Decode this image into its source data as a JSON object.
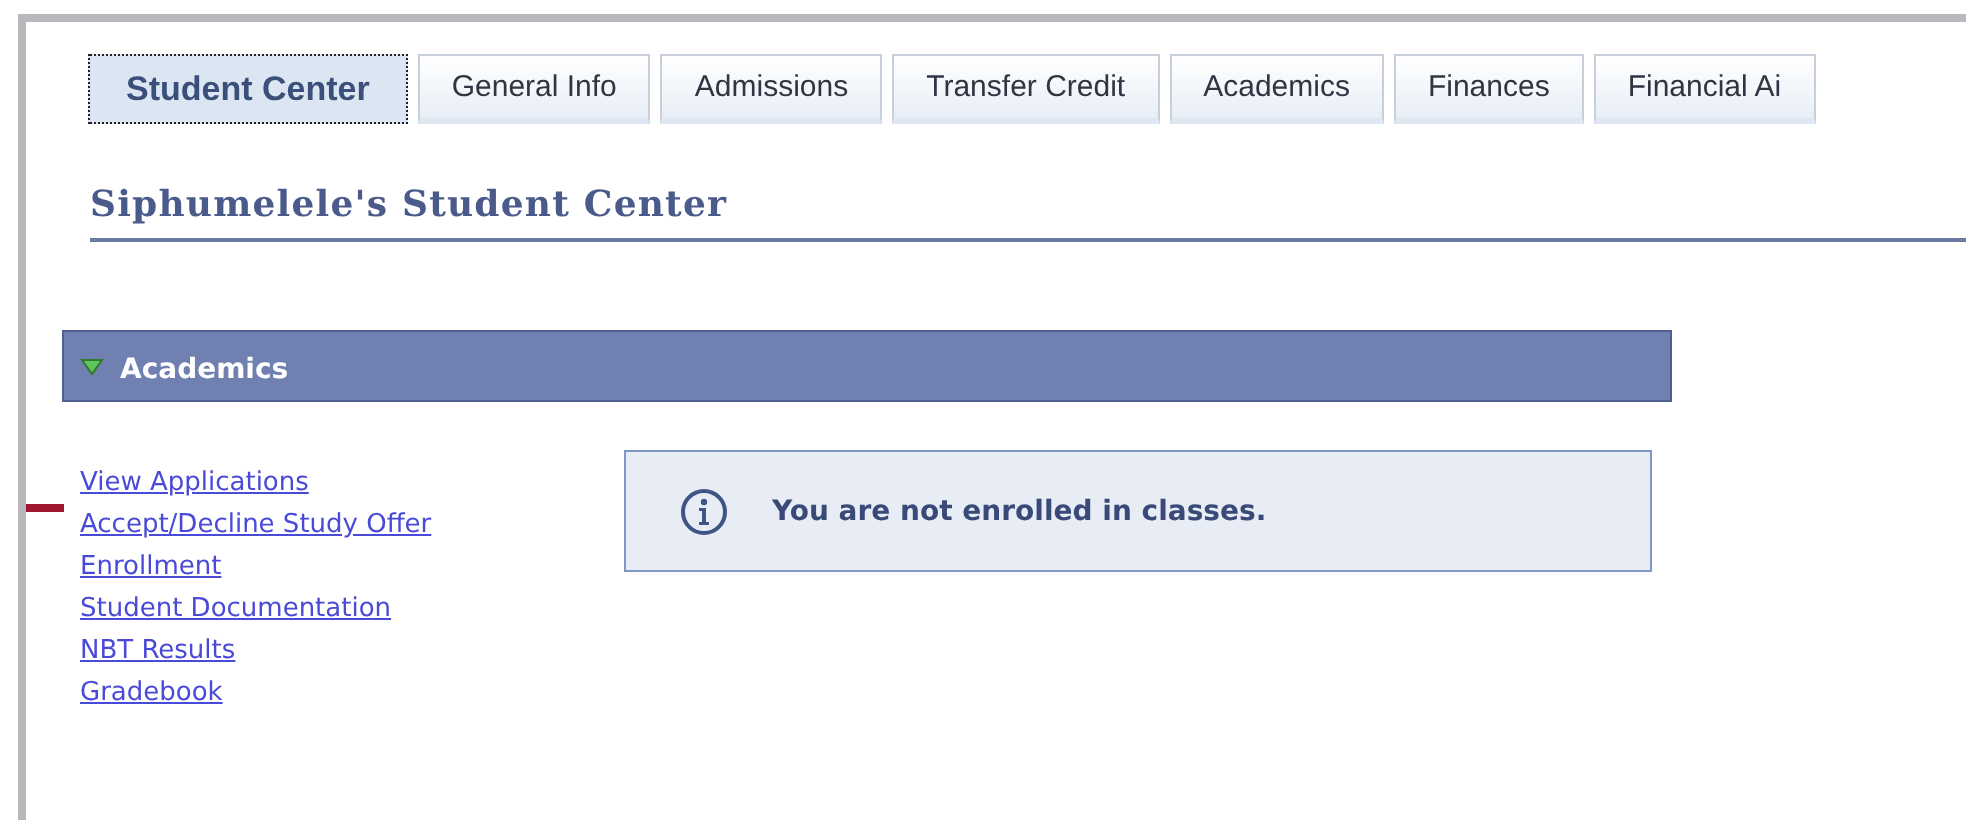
{
  "tabs": [
    {
      "label": "Student Center",
      "selected": true
    },
    {
      "label": "General Info",
      "selected": false
    },
    {
      "label": "Admissions",
      "selected": false
    },
    {
      "label": "Transfer Credit",
      "selected": false
    },
    {
      "label": "Academics",
      "selected": false
    },
    {
      "label": "Finances",
      "selected": false
    },
    {
      "label": "Financial Ai",
      "selected": false
    }
  ],
  "page_title": "Siphumelele's Student Center",
  "section": {
    "title": "Academics",
    "expanded": true
  },
  "links": [
    "View Applications",
    "Accept/Decline Study Offer",
    "Enrollment",
    "Student Documentation",
    "NBT Results",
    "Gradebook"
  ],
  "message": "You are not enrolled in classes."
}
